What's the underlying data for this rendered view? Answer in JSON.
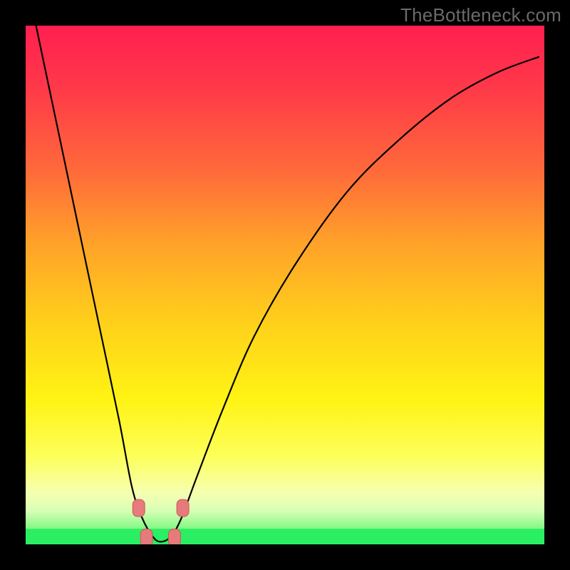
{
  "watermark": "TheBottleneck.com",
  "colors": {
    "frame": "#000000",
    "curve": "#000000",
    "marker_fill": "#e77a7a",
    "marker_stroke": "#c85a5a",
    "green_band": "#2bef62",
    "gradient_stops": [
      {
        "offset": 0.0,
        "color": "#ff1f4f"
      },
      {
        "offset": 0.12,
        "color": "#ff3949"
      },
      {
        "offset": 0.28,
        "color": "#ff6a3a"
      },
      {
        "offset": 0.42,
        "color": "#ffa229"
      },
      {
        "offset": 0.58,
        "color": "#ffd21a"
      },
      {
        "offset": 0.72,
        "color": "#fff314"
      },
      {
        "offset": 0.83,
        "color": "#fdff5a"
      },
      {
        "offset": 0.9,
        "color": "#f6ffb0"
      },
      {
        "offset": 0.935,
        "color": "#d8ffb6"
      },
      {
        "offset": 0.965,
        "color": "#8ef98b"
      },
      {
        "offset": 1.0,
        "color": "#2bef62"
      }
    ]
  },
  "chart_data": {
    "type": "line",
    "title": "",
    "xlabel": "",
    "ylabel": "",
    "xlim": [
      0,
      1
    ],
    "ylim": [
      0,
      1
    ],
    "note": "Axes are unlabeled in the source image; x and curve values are normalized 0–1 within the plot rectangle. The curve is a V-shaped smooth function with its minimum near x≈0.26, y≈0; y increases toward 1 at both x-extremes (steeper on the left branch).",
    "series": [
      {
        "name": "bottleneck-curve",
        "x": [
          0.02,
          0.06,
          0.1,
          0.14,
          0.18,
          0.205,
          0.225,
          0.245,
          0.26,
          0.28,
          0.3,
          0.33,
          0.38,
          0.44,
          0.52,
          0.62,
          0.72,
          0.82,
          0.91,
          0.99
        ],
        "y": [
          1.0,
          0.81,
          0.62,
          0.43,
          0.24,
          0.11,
          0.05,
          0.015,
          0.005,
          0.015,
          0.05,
          0.13,
          0.26,
          0.4,
          0.54,
          0.68,
          0.78,
          0.86,
          0.91,
          0.94
        ]
      }
    ],
    "markers": {
      "name": "sweet-spot-markers",
      "shape": "rounded-rect",
      "points": [
        {
          "x": 0.218,
          "y": 0.07
        },
        {
          "x": 0.233,
          "y": 0.013
        },
        {
          "x": 0.287,
          "y": 0.013
        },
        {
          "x": 0.303,
          "y": 0.07
        }
      ]
    },
    "bands": [
      {
        "name": "green-good-zone",
        "y0": 0.0,
        "y1": 0.03
      }
    ]
  }
}
